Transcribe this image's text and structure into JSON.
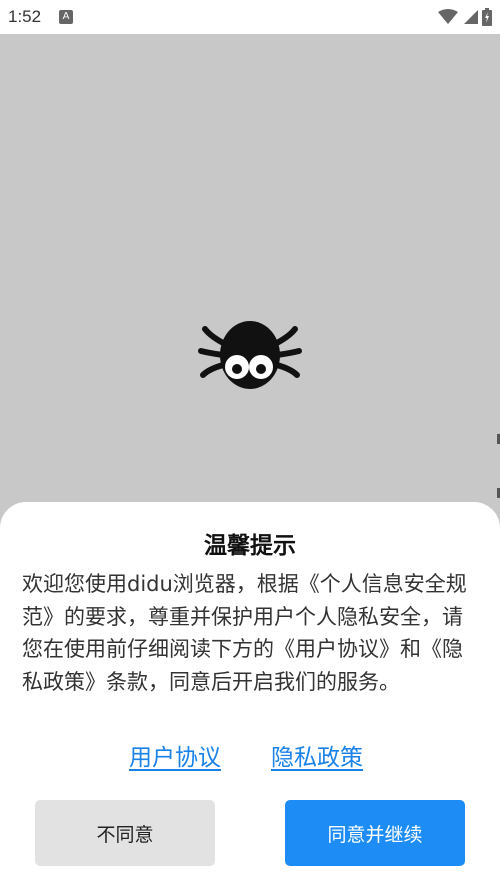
{
  "status_bar": {
    "time": "1:52",
    "app_icon_glyph": "A",
    "icons": [
      "wifi-icon",
      "signal-icon",
      "battery-icon"
    ]
  },
  "splash": {
    "logo_icon": "spider-icon"
  },
  "dialog": {
    "title": "温馨提示",
    "body": "欢迎您使用didu浏览器，根据《个人信息安全规范》的要求，尊重并保护用户个人隐私安全，请您在使用前仔细阅读下方的《用户协议》和《隐私政策》条款，同意后开启我们的服务。",
    "links": {
      "user_agreement": "用户协议",
      "privacy_policy": "隐私政策"
    },
    "buttons": {
      "disagree": "不同意",
      "agree": "同意并继续"
    }
  },
  "colors": {
    "link": "#1a82e8",
    "primary_button": "#1e8cf5",
    "secondary_button": "#e2e2e2",
    "backdrop": "#c8c8c8"
  }
}
